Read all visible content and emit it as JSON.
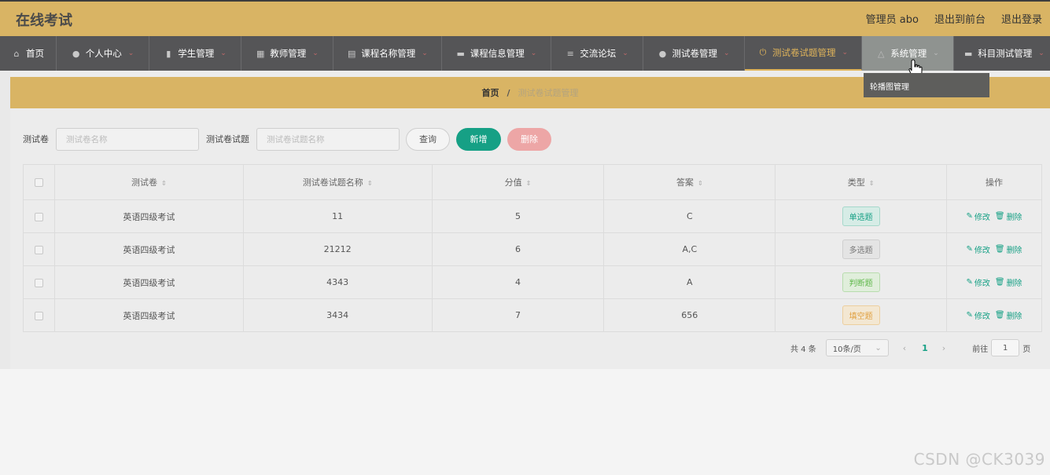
{
  "app": {
    "title": "在线考试",
    "top_links": [
      "管理员 abo",
      "退出到前台",
      "退出登录"
    ]
  },
  "nav": [
    {
      "label": "首页",
      "icon": "home-icon",
      "glyph": "⌂",
      "dropdown": false
    },
    {
      "label": "个人中心",
      "icon": "person-icon",
      "glyph": "●",
      "dropdown": true
    },
    {
      "label": "学生管理",
      "icon": "chart-bars-icon",
      "glyph": "▮",
      "dropdown": true
    },
    {
      "label": "教师管理",
      "icon": "grid-icon",
      "glyph": "▦",
      "dropdown": true
    },
    {
      "label": "课程名称管理",
      "icon": "clipboard-icon",
      "glyph": "▤",
      "dropdown": true
    },
    {
      "label": "课程信息管理",
      "icon": "monitor-icon",
      "glyph": "▬",
      "dropdown": true
    },
    {
      "label": "交流论坛",
      "icon": "list-icon",
      "glyph": "≡",
      "dropdown": true
    },
    {
      "label": "测试卷管理",
      "icon": "person-icon",
      "glyph": "●",
      "dropdown": true
    },
    {
      "label": "测试卷试题管理",
      "icon": "power-icon",
      "glyph": "⏻",
      "dropdown": true,
      "active": true
    },
    {
      "label": "系统管理",
      "icon": "bell-icon",
      "glyph": "△",
      "dropdown": true,
      "hover": true
    },
    {
      "label": "科目测试管理",
      "icon": "monitor-icon",
      "glyph": "▬",
      "dropdown": true
    }
  ],
  "dropdown_menu": {
    "items": [
      "轮播图管理"
    ]
  },
  "breadcrumb": {
    "home": "首页",
    "separator": "/",
    "current": "测试卷试题管理"
  },
  "filters": {
    "paper_label": "测试卷",
    "paper_placeholder": "测试卷名称",
    "question_label": "测试卷试题",
    "question_placeholder": "测试卷试题名称",
    "query_button": "查询",
    "add_button": "新增",
    "delete_button": "删除"
  },
  "table": {
    "columns": [
      "测试卷",
      "测试卷试题名称",
      "分值",
      "答案",
      "类型",
      "操作"
    ],
    "rows": [
      {
        "paper": "英语四级考试",
        "question": "11",
        "score": "5",
        "answer": "C",
        "type": "单选题"
      },
      {
        "paper": "英语四级考试",
        "question": "21212",
        "score": "6",
        "answer": "A,C",
        "type": "多选题"
      },
      {
        "paper": "英语四级考试",
        "question": "4343",
        "score": "4",
        "answer": "A",
        "type": "判断题"
      },
      {
        "paper": "英语四级考试",
        "question": "3434",
        "score": "7",
        "answer": "656",
        "type": "填空题"
      }
    ],
    "edit_label": "修改",
    "delete_label": "删除"
  },
  "type_colors": {
    "单选题": {
      "fg": "#16a085",
      "bg": "#d6ece6",
      "border": "#a6d8cb"
    },
    "多选题": {
      "fg": "#777777",
      "bg": "#e4e4e4",
      "border": "#cfcfcf"
    },
    "判断题": {
      "fg": "#5fb84b",
      "bg": "#e0eedb",
      "border": "#b8dcae"
    },
    "填空题": {
      "fg": "#e0a040",
      "bg": "#f3e7d2",
      "border": "#edcf9e"
    }
  },
  "pagination": {
    "total": "共 4 条",
    "page_size": "10条/页",
    "current_page": "1",
    "goto_prefix": "前往",
    "goto_value": "1",
    "goto_suffix": "页"
  },
  "watermark": "CSDN @CK3039",
  "colors": {
    "accent": "#16a085",
    "header": "#d9b464",
    "nav": "#555557",
    "nav_active": "#e0b45a"
  }
}
